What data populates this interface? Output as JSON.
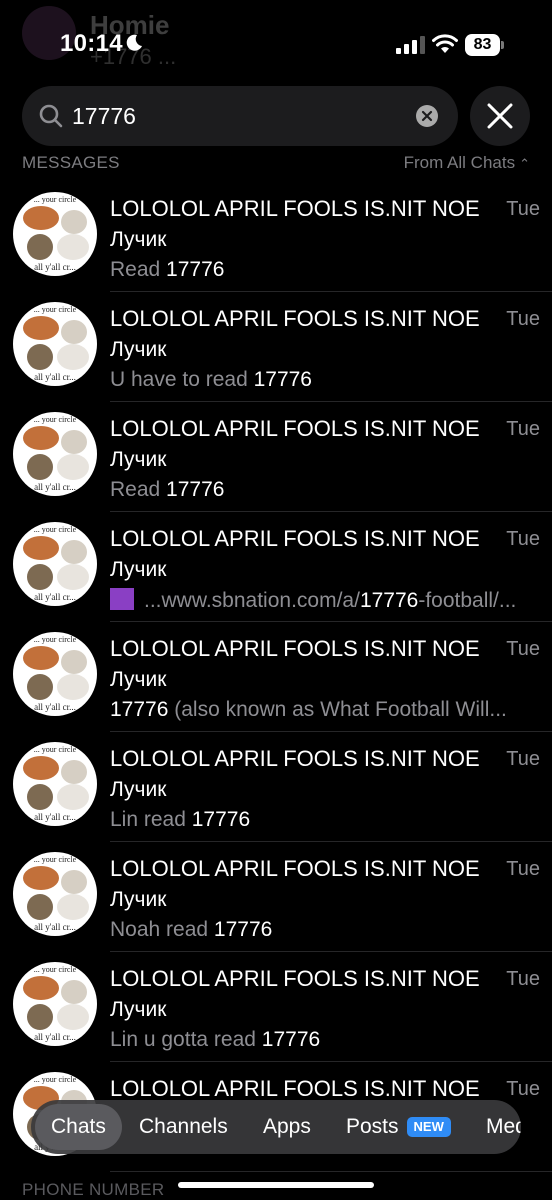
{
  "status": {
    "time": "10:14",
    "battery": "83"
  },
  "ghost": {
    "name": "Homie",
    "sub": "+1776 ..."
  },
  "search": {
    "query": "17776"
  },
  "section": {
    "title": "MESSAGES",
    "filter": "From All Chats"
  },
  "results": [
    {
      "title": "LOLOLOL APRIL FOOLS IS.NIT NOE",
      "time": "Tue",
      "sender": "Лучик",
      "pre": "Read ",
      "hit": "17776",
      "post": ""
    },
    {
      "title": "LOLOLOL APRIL FOOLS IS.NIT NOE",
      "time": "Tue",
      "sender": "Лучик",
      "pre": "U have to read ",
      "hit": "17776",
      "post": ""
    },
    {
      "title": "LOLOLOL APRIL FOOLS IS.NIT NOE",
      "time": "Tue",
      "sender": "Лучик",
      "pre": "Read ",
      "hit": "17776",
      "post": ""
    },
    {
      "title": "LOLOLOL APRIL FOOLS IS.NIT NOE",
      "time": "Tue",
      "sender": "Лучик",
      "pre": "...www.sbnation.com/a/",
      "hit": "17776",
      "post": "-football/..."
    },
    {
      "title": "LOLOLOL APRIL FOOLS IS.NIT NOE",
      "time": "Tue",
      "sender": "Лучик",
      "pre": "",
      "hit": "17776",
      "post": " (also known as What Football Will..."
    },
    {
      "title": "LOLOLOL APRIL FOOLS IS.NIT NOE",
      "time": "Tue",
      "sender": "Лучик",
      "pre": "Lin read ",
      "hit": "17776",
      "post": ""
    },
    {
      "title": "LOLOLOL APRIL FOOLS IS.NIT NOE",
      "time": "Tue",
      "sender": "Лучик",
      "pre": "Noah read ",
      "hit": "17776",
      "post": ""
    },
    {
      "title": "LOLOLOL APRIL FOOLS IS.NIT NOE",
      "time": "Tue",
      "sender": "Лучик",
      "pre": "Lin u gotta read ",
      "hit": "17776",
      "post": ""
    },
    {
      "title": "LOLOLOL APRIL FOOLS IS.NIT NOE",
      "time": "Tue",
      "sender": "",
      "pre": "",
      "hit": "",
      "post": ""
    }
  ],
  "avatar": {
    "caption_top": "... your circle",
    "caption_bottom": "all y'all cr..."
  },
  "phone_section": "PHONE NUMBER",
  "tabs": {
    "chats": "Chats",
    "channels": "Channels",
    "apps": "Apps",
    "posts": "Posts",
    "new_badge": "NEW",
    "media": "Med"
  },
  "colors": {
    "background": "#000000",
    "accent": "#2f8cf6",
    "secondary_text": "#8e8e93"
  }
}
